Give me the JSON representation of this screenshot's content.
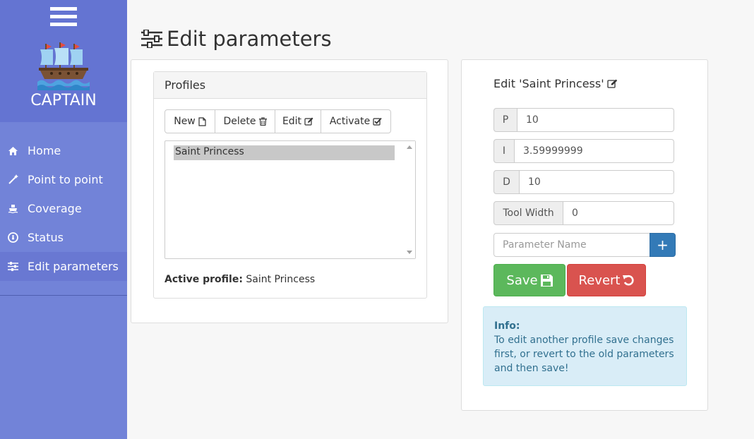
{
  "app": {
    "name": "CAPTAIN"
  },
  "sidebar": {
    "items": [
      {
        "label": "Home",
        "icon": "home-icon"
      },
      {
        "label": "Point to point",
        "icon": "magic-wand-icon"
      },
      {
        "label": "Coverage",
        "icon": "ship-icon"
      },
      {
        "label": "Status",
        "icon": "dashboard-icon"
      },
      {
        "label": "Edit parameters",
        "icon": "sliders-icon",
        "active": true
      }
    ]
  },
  "page": {
    "title": "Edit parameters"
  },
  "profiles": {
    "heading": "Profiles",
    "buttons": {
      "new": "New",
      "delete": "Delete",
      "edit": "Edit",
      "activate": "Activate"
    },
    "list": [
      "Saint Princess"
    ],
    "active_label": "Active profile:",
    "active_value": "Saint Princess"
  },
  "editor": {
    "title": "Edit 'Saint Princess'",
    "params": [
      {
        "name": "P",
        "value": "10"
      },
      {
        "name": "I",
        "value": "3.59999999"
      },
      {
        "name": "D",
        "value": "10"
      },
      {
        "name": "Tool Width",
        "value": "0"
      }
    ],
    "name_placeholder": "Parameter Name",
    "add_label": "+",
    "save_label": "Save",
    "revert_label": "Revert"
  },
  "info": {
    "title": "Info:",
    "text": "To edit another profile save changes first, or revert to the old parameters and then save!"
  },
  "colors": {
    "sidebar": "#7283d8",
    "brand": "#6474d2",
    "primary": "#337ab7",
    "success": "#5cb85c",
    "danger": "#d9534f",
    "info_bg": "#d9edf7"
  }
}
